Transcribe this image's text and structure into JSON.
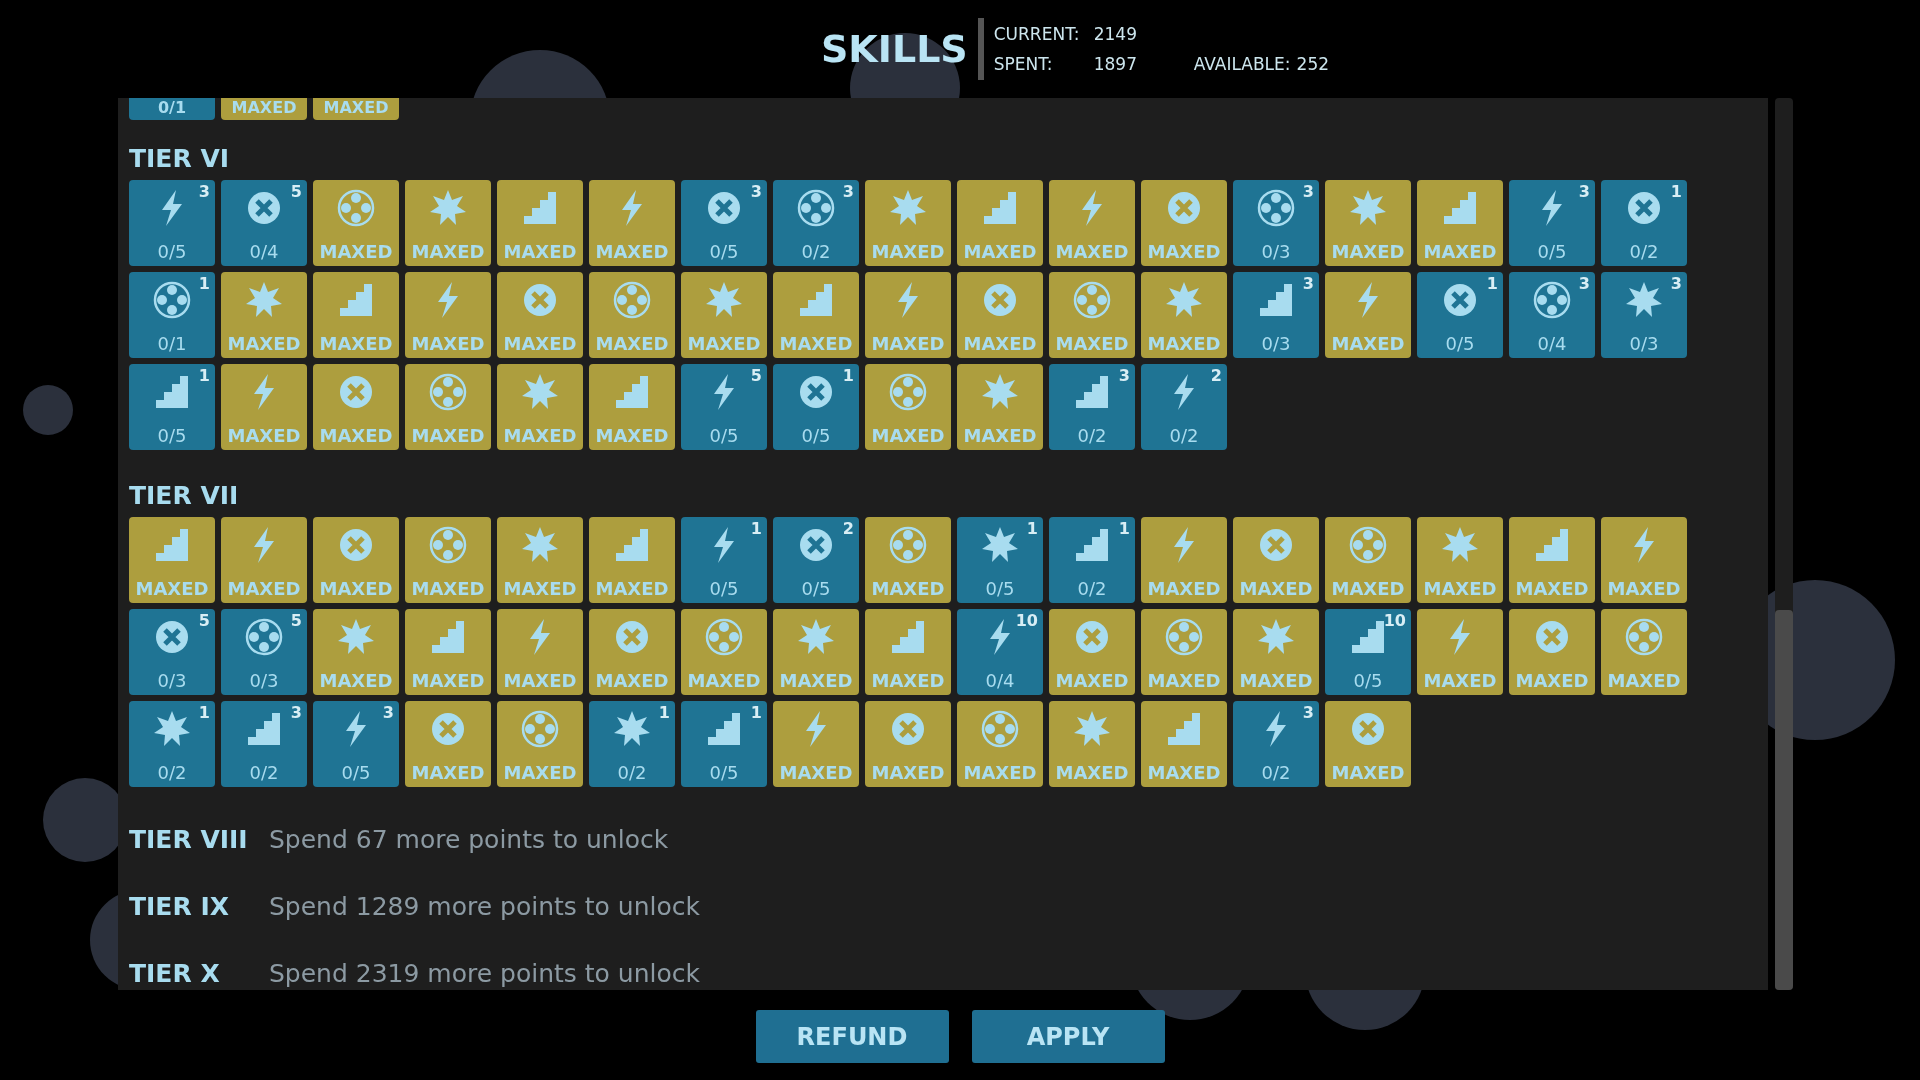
{
  "title": "SKILLS",
  "points": {
    "current_label": "CURRENT:",
    "current": "2149",
    "spent_label": "SPENT:",
    "spent": "1897",
    "available_label": "AVAILABLE:",
    "available": "252"
  },
  "previous_row": [
    {
      "status": "0/1",
      "maxed": false
    },
    {
      "status": "MAXED",
      "maxed": true
    },
    {
      "status": "MAXED",
      "maxed": true
    }
  ],
  "tiers": [
    {
      "name": "TIER VI",
      "tiles": [
        {
          "status": "0/5",
          "badge": "3",
          "maxed": false
        },
        {
          "status": "0/4",
          "badge": "5",
          "maxed": false
        },
        {
          "status": "MAXED",
          "maxed": true
        },
        {
          "status": "MAXED",
          "maxed": true
        },
        {
          "status": "MAXED",
          "maxed": true
        },
        {
          "status": "MAXED",
          "maxed": true
        },
        {
          "status": "0/5",
          "badge": "3",
          "maxed": false
        },
        {
          "status": "0/2",
          "badge": "3",
          "maxed": false
        },
        {
          "status": "MAXED",
          "maxed": true
        },
        {
          "status": "MAXED",
          "maxed": true
        },
        {
          "status": "MAXED",
          "maxed": true
        },
        {
          "status": "MAXED",
          "maxed": true
        },
        {
          "status": "0/3",
          "badge": "3",
          "maxed": false
        },
        {
          "status": "MAXED",
          "maxed": true
        },
        {
          "status": "MAXED",
          "maxed": true
        },
        {
          "status": "0/5",
          "badge": "3",
          "maxed": false
        },
        {
          "status": "0/2",
          "badge": "1",
          "maxed": false
        },
        {
          "status": "0/1",
          "badge": "1",
          "maxed": false
        },
        {
          "status": "MAXED",
          "maxed": true
        },
        {
          "status": "MAXED",
          "maxed": true
        },
        {
          "status": "MAXED",
          "maxed": true
        },
        {
          "status": "MAXED",
          "maxed": true
        },
        {
          "status": "MAXED",
          "maxed": true
        },
        {
          "status": "MAXED",
          "maxed": true
        },
        {
          "status": "MAXED",
          "maxed": true
        },
        {
          "status": "MAXED",
          "maxed": true
        },
        {
          "status": "MAXED",
          "maxed": true
        },
        {
          "status": "MAXED",
          "maxed": true
        },
        {
          "status": "MAXED",
          "maxed": true
        },
        {
          "status": "0/3",
          "badge": "3",
          "maxed": false
        },
        {
          "status": "MAXED",
          "maxed": true
        },
        {
          "status": "0/5",
          "badge": "1",
          "maxed": false
        },
        {
          "status": "0/4",
          "badge": "3",
          "maxed": false
        },
        {
          "status": "0/3",
          "badge": "3",
          "maxed": false
        },
        {
          "status": "0/5",
          "badge": "1",
          "maxed": false
        },
        {
          "status": "MAXED",
          "maxed": true
        },
        {
          "status": "MAXED",
          "maxed": true
        },
        {
          "status": "MAXED",
          "maxed": true
        },
        {
          "status": "MAXED",
          "maxed": true
        },
        {
          "status": "MAXED",
          "maxed": true
        },
        {
          "status": "0/5",
          "badge": "5",
          "maxed": false
        },
        {
          "status": "0/5",
          "badge": "1",
          "maxed": false
        },
        {
          "status": "MAXED",
          "maxed": true
        },
        {
          "status": "MAXED",
          "maxed": true
        },
        {
          "status": "0/2",
          "badge": "3",
          "maxed": false
        },
        {
          "status": "0/2",
          "badge": "2",
          "maxed": false
        }
      ]
    },
    {
      "name": "TIER VII",
      "tiles": [
        {
          "status": "MAXED",
          "maxed": true
        },
        {
          "status": "MAXED",
          "maxed": true
        },
        {
          "status": "MAXED",
          "maxed": true
        },
        {
          "status": "MAXED",
          "maxed": true
        },
        {
          "status": "MAXED",
          "maxed": true
        },
        {
          "status": "MAXED",
          "maxed": true
        },
        {
          "status": "0/5",
          "badge": "1",
          "maxed": false
        },
        {
          "status": "0/5",
          "badge": "2",
          "maxed": false
        },
        {
          "status": "MAXED",
          "maxed": true
        },
        {
          "status": "0/5",
          "badge": "1",
          "maxed": false
        },
        {
          "status": "0/2",
          "badge": "1",
          "maxed": false
        },
        {
          "status": "MAXED",
          "maxed": true
        },
        {
          "status": "MAXED",
          "maxed": true
        },
        {
          "status": "MAXED",
          "maxed": true
        },
        {
          "status": "MAXED",
          "maxed": true
        },
        {
          "status": "MAXED",
          "maxed": true
        },
        {
          "status": "MAXED",
          "maxed": true
        },
        {
          "status": "0/3",
          "badge": "5",
          "maxed": false
        },
        {
          "status": "0/3",
          "badge": "5",
          "maxed": false
        },
        {
          "status": "MAXED",
          "maxed": true
        },
        {
          "status": "MAXED",
          "maxed": true
        },
        {
          "status": "MAXED",
          "maxed": true
        },
        {
          "status": "MAXED",
          "maxed": true
        },
        {
          "status": "MAXED",
          "maxed": true
        },
        {
          "status": "MAXED",
          "maxed": true
        },
        {
          "status": "MAXED",
          "maxed": true
        },
        {
          "status": "0/4",
          "badge": "10",
          "maxed": false
        },
        {
          "status": "MAXED",
          "maxed": true
        },
        {
          "status": "MAXED",
          "maxed": true
        },
        {
          "status": "MAXED",
          "maxed": true
        },
        {
          "status": "0/5",
          "badge": "10",
          "maxed": false
        },
        {
          "status": "MAXED",
          "maxed": true
        },
        {
          "status": "MAXED",
          "maxed": true
        },
        {
          "status": "MAXED",
          "maxed": true
        },
        {
          "status": "0/2",
          "badge": "1",
          "maxed": false
        },
        {
          "status": "0/2",
          "badge": "3",
          "maxed": false
        },
        {
          "status": "0/5",
          "badge": "3",
          "maxed": false
        },
        {
          "status": "MAXED",
          "maxed": true
        },
        {
          "status": "MAXED",
          "maxed": true
        },
        {
          "status": "0/2",
          "badge": "1",
          "maxed": false
        },
        {
          "status": "0/5",
          "badge": "1",
          "maxed": false
        },
        {
          "status": "MAXED",
          "maxed": true
        },
        {
          "status": "MAXED",
          "maxed": true
        },
        {
          "status": "MAXED",
          "maxed": true
        },
        {
          "status": "MAXED",
          "maxed": true
        },
        {
          "status": "MAXED",
          "maxed": true
        },
        {
          "status": "0/2",
          "badge": "3",
          "maxed": false
        },
        {
          "status": "MAXED",
          "maxed": true
        }
      ]
    }
  ],
  "locked_tiers": [
    {
      "name": "TIER VIII",
      "note": "Spend 67 more points to unlock"
    },
    {
      "name": "TIER IX",
      "note": "Spend 1289 more points to unlock"
    },
    {
      "name": "TIER X",
      "note": "Spend 2319 more points to unlock"
    }
  ],
  "buttons": [
    "REFUND",
    "APPLY"
  ]
}
